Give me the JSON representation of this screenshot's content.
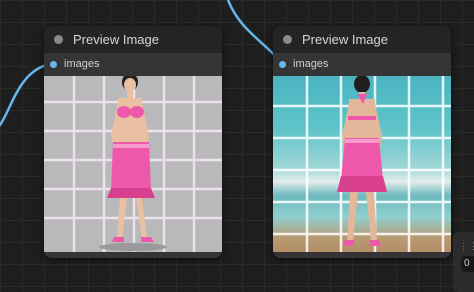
{
  "nodes": [
    {
      "title": "Preview Image",
      "input_label": "images"
    },
    {
      "title": "Preview Image",
      "input_label": "images"
    }
  ],
  "side_widget": {
    "value": "0"
  },
  "colors": {
    "canvas_bg": "#1e1e1e",
    "node_bg": "#353535",
    "node_header": "#242424",
    "wire": "#67b7ea",
    "slot": "#67b7ea",
    "outfit_pink": "#ee58aa"
  }
}
